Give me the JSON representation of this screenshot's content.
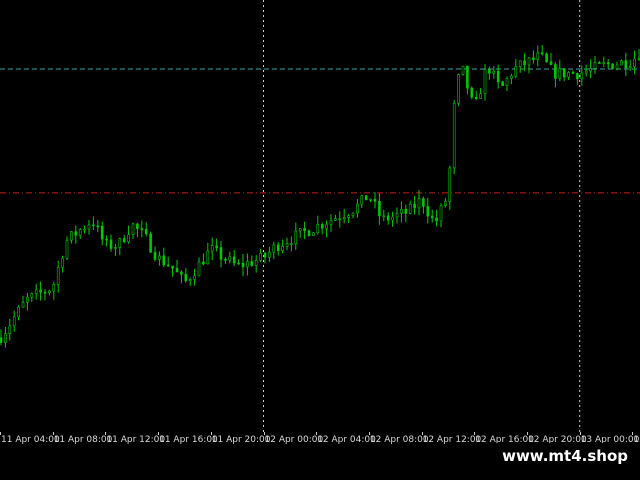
{
  "chart_data": {
    "type": "candlestick",
    "up_color": "#00c800",
    "down_color": "#00c800",
    "background": "#000000",
    "grid": false,
    "ylim": [
      0,
      100
    ],
    "price_levels": [
      {
        "y": 85,
        "color": "#3fa0a0",
        "style": "dash"
      },
      {
        "y": 55.5,
        "color": "#c81e1e",
        "style": "dash-dot"
      }
    ],
    "x_ticks": [
      "11 Apr 04:00",
      "11 Apr 08:00",
      "11 Apr 12:00",
      "11 Apr 16:00",
      "11 Apr 20:00",
      "12 Apr 00:00",
      "12 Apr 04:00",
      "12 Apr 08:00",
      "12 Apr 12:00",
      "12 Apr 16:00",
      "12 Apr 20:00",
      "13 Apr 00:00",
      "13"
    ],
    "vertical_markers": [
      "12 Apr 00:00",
      "13 Apr 00:00"
    ],
    "series": [
      {
        "x": "11 Apr 04:00",
        "y": 21
      },
      {
        "x": "11 Apr 06:00",
        "y": 30
      },
      {
        "x": "11 Apr 08:00",
        "y": 33
      },
      {
        "x": "11 Apr 09:00",
        "y": 44
      },
      {
        "x": "11 Apr 11:00",
        "y": 49
      },
      {
        "x": "11 Apr 12:00",
        "y": 43
      },
      {
        "x": "11 Apr 13:00",
        "y": 43
      },
      {
        "x": "11 Apr 14:00",
        "y": 48
      },
      {
        "x": "11 Apr 15:00",
        "y": 45
      },
      {
        "x": "11 Apr 16:00",
        "y": 40
      },
      {
        "x": "11 Apr 17:00",
        "y": 38
      },
      {
        "x": "11 Apr 18:00",
        "y": 34
      },
      {
        "x": "11 Apr 20:00",
        "y": 42
      },
      {
        "x": "11 Apr 21:00",
        "y": 40
      },
      {
        "x": "11 Apr 22:00",
        "y": 38
      },
      {
        "x": "12 Apr 00:00",
        "y": 40
      },
      {
        "x": "12 Apr 01:00",
        "y": 43
      },
      {
        "x": "12 Apr 03:00",
        "y": 46
      },
      {
        "x": "12 Apr 05:00",
        "y": 49
      },
      {
        "x": "12 Apr 07:00",
        "y": 52
      },
      {
        "x": "12 Apr 08:00",
        "y": 55
      },
      {
        "x": "12 Apr 09:00",
        "y": 49
      },
      {
        "x": "12 Apr 11:00",
        "y": 51
      },
      {
        "x": "12 Apr 12:00",
        "y": 54
      },
      {
        "x": "12 Apr 13:00",
        "y": 48
      },
      {
        "x": "12 Apr 14:00",
        "y": 55
      },
      {
        "x": "12 Apr 14:30",
        "y": 77
      },
      {
        "x": "12 Apr 15:00",
        "y": 86
      },
      {
        "x": "12 Apr 16:00",
        "y": 75
      },
      {
        "x": "12 Apr 17:00",
        "y": 86
      },
      {
        "x": "12 Apr 18:00",
        "y": 80
      },
      {
        "x": "12 Apr 19:00",
        "y": 85
      },
      {
        "x": "12 Apr 21:00",
        "y": 88
      },
      {
        "x": "12 Apr 22:00",
        "y": 84
      },
      {
        "x": "13 Apr 00:00",
        "y": 84
      },
      {
        "x": "13 Apr 02:00",
        "y": 86
      },
      {
        "x": "13 Apr 04:00",
        "y": 87
      },
      {
        "x": "13 Apr 05:00",
        "y": 91
      }
    ]
  },
  "watermark": "www.mt4.shop"
}
